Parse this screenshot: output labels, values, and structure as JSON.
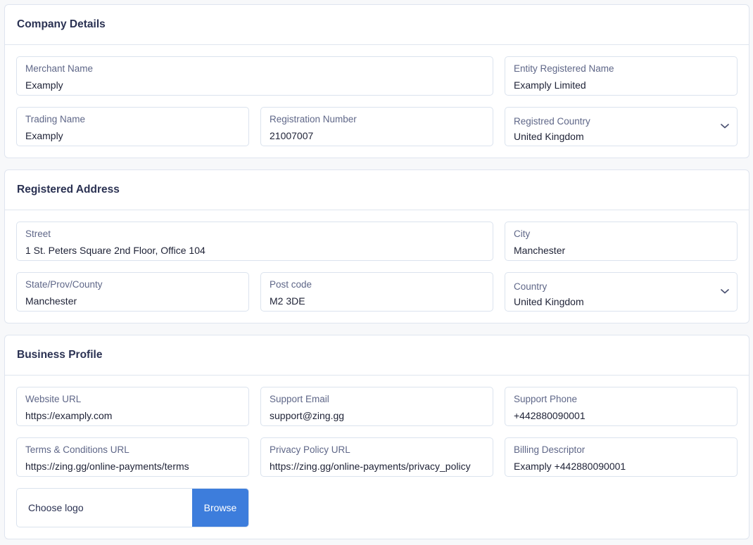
{
  "company_details": {
    "title": "Company Details",
    "merchant_name": {
      "label": "Merchant Name",
      "value": "Examply"
    },
    "entity_registered_name": {
      "label": "Entity Registered Name",
      "value": "Examply Limited"
    },
    "trading_name": {
      "label": "Trading Name",
      "value": "Examply"
    },
    "registration_number": {
      "label": "Registration Number",
      "value": "21007007"
    },
    "registered_country": {
      "label": "Registred Country",
      "value": "United Kingdom"
    }
  },
  "registered_address": {
    "title": "Registered Address",
    "street": {
      "label": "Street",
      "value": "1 St. Peters Square 2nd Floor, Office 104"
    },
    "city": {
      "label": "City",
      "value": "Manchester"
    },
    "state": {
      "label": "State/Prov/County",
      "value": "Manchester"
    },
    "post_code": {
      "label": "Post code",
      "value": "M2 3DE"
    },
    "country": {
      "label": "Country",
      "value": "United Kingdom"
    }
  },
  "business_profile": {
    "title": "Business Profile",
    "website_url": {
      "label": "Website URL",
      "value": "https://examply.com"
    },
    "support_email": {
      "label": "Support Email",
      "value": "support@zing.gg"
    },
    "support_phone": {
      "label": "Support Phone",
      "value": "+442880090001"
    },
    "terms_url": {
      "label": "Terms & Conditions URL",
      "value": "https://zing.gg/online-payments/terms"
    },
    "privacy_url": {
      "label": "Privacy Policy URL",
      "value": "https://zing.gg/online-payments/privacy_policy"
    },
    "billing_descriptor": {
      "label": "Billing Descriptor",
      "value": "Examply +442880090001"
    },
    "logo": {
      "label": "Choose logo",
      "button": "Browse"
    }
  },
  "colors": {
    "accent": "#3d7ddc",
    "border": "#dbe3ee",
    "label": "#5f6788",
    "heading": "#2a3152"
  },
  "icons": {
    "select_chevron": "chevron-down-icon"
  }
}
